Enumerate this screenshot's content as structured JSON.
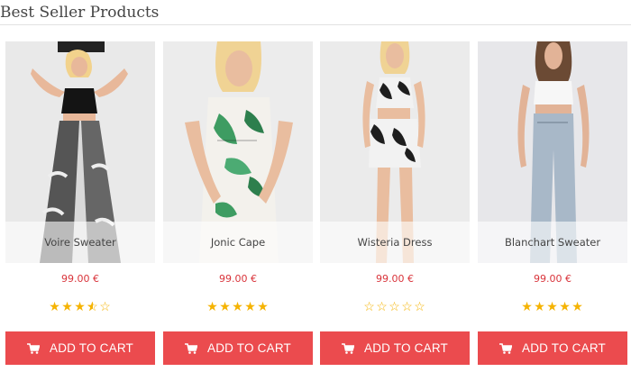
{
  "section": {
    "title": "Best Seller Products"
  },
  "products": [
    {
      "name": "Voire Sweater",
      "price": "99.00 €",
      "rating": 3.5,
      "button_label": "ADD TO CART"
    },
    {
      "name": "Jonic Cape",
      "price": "99.00 €",
      "rating": 5,
      "button_label": "ADD TO CART"
    },
    {
      "name": "Wisteria Dress",
      "price": "99.00 €",
      "rating": 0,
      "button_label": "ADD TO CART"
    },
    {
      "name": "Blanchart Sweater",
      "price": "99.00 €",
      "rating": 5,
      "button_label": "ADD TO CART"
    }
  ],
  "rating_max": 5,
  "colors": {
    "accent": "#eb4b4e",
    "price": "#d9343b",
    "star": "#f5b301",
    "title": "#444444"
  },
  "icons": {
    "cart": "shopping-cart-icon",
    "star": "star-icon"
  }
}
